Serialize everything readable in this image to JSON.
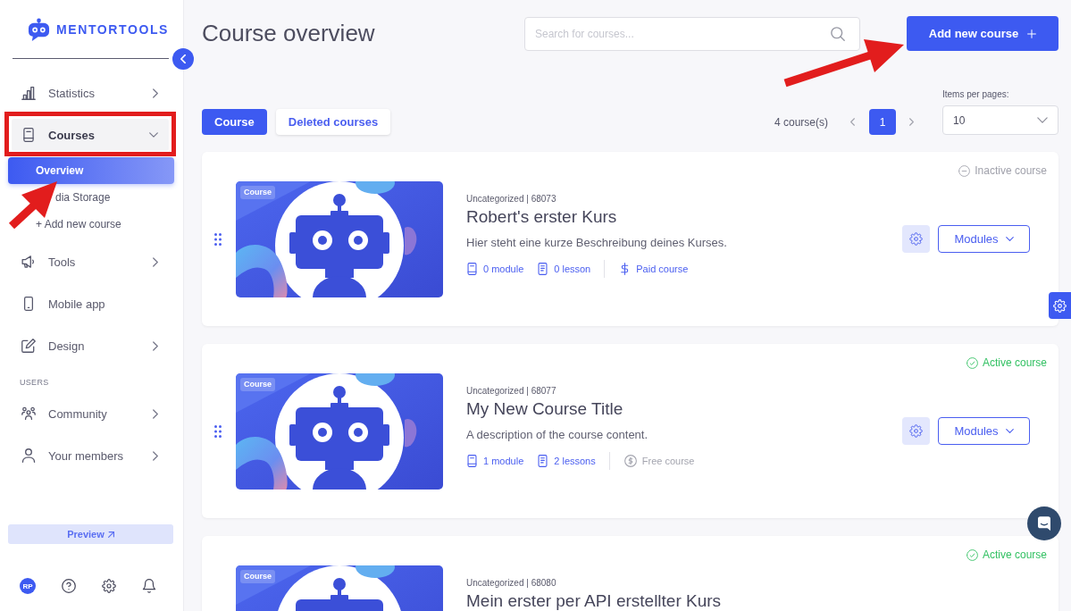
{
  "sidebar": {
    "logo": "MENTORTOOLS",
    "nav": [
      {
        "label": "Statistics",
        "expanded": false
      },
      {
        "label": "Courses",
        "expanded": true,
        "annotation_box": true,
        "children": [
          {
            "label": "Overview",
            "selected": true
          },
          {
            "label": "dia Storage",
            "selected": false
          },
          {
            "label": "+ Add new course",
            "selected": false
          }
        ]
      },
      {
        "label": "Tools",
        "expanded": false
      },
      {
        "label": "Mobile app"
      },
      {
        "label": "Design",
        "expanded": false
      }
    ],
    "annotations": [
      {
        "kind": "arrow"
      }
    ],
    "users": {
      "heading": "USERS",
      "nav": [
        {
          "label": "Community",
          "expanded": false
        },
        {
          "label": "Your members",
          "expanded": false
        }
      ]
    },
    "preview_button": "Preview",
    "avatar_initials": "RP"
  },
  "header": {
    "title": "Course overview",
    "search": {
      "placeholder": "Search for courses..."
    },
    "add_button": {
      "label": "Add new course",
      "annotation_arrow": true
    }
  },
  "toolbar": {
    "tabs": [
      {
        "label": "Course",
        "selected": true
      },
      {
        "label": "Deleted courses",
        "selected": false
      }
    ],
    "count": "4 course(s)",
    "pages": [
      {
        "label": "1",
        "selected": true
      }
    ],
    "items_per_page": {
      "label": "Items per pages:",
      "value": "10"
    }
  },
  "courses": [
    {
      "drag_handle": true,
      "image_label": "Course",
      "category": "Uncategorized | 68073",
      "title": "Robert's erster Kurs",
      "description": "Hier steht eine kurze Beschreibung deines Kurses.",
      "modules": "0 module",
      "lessons": "0 lesson",
      "price": {
        "label": "Paid course",
        "paid": true
      },
      "status": {
        "label": "Inactive course",
        "active": false
      },
      "actions": "Modules"
    },
    {
      "drag_handle": true,
      "image_label": "Course",
      "category": "Uncategorized | 68077",
      "title": "My New Course Title",
      "description": "A description of the course content.",
      "modules": "1 module",
      "lessons": "2 lessons",
      "price": {
        "label": "Free course",
        "paid": false
      },
      "status": {
        "label": "Active course",
        "active": true
      },
      "actions": "Modules"
    },
    {
      "image_label": "Course",
      "category": "Uncategorized | 68080",
      "title": "Mein erster per API erstellter Kurs",
      "status": {
        "label": "Active course",
        "active": true
      }
    }
  ]
}
